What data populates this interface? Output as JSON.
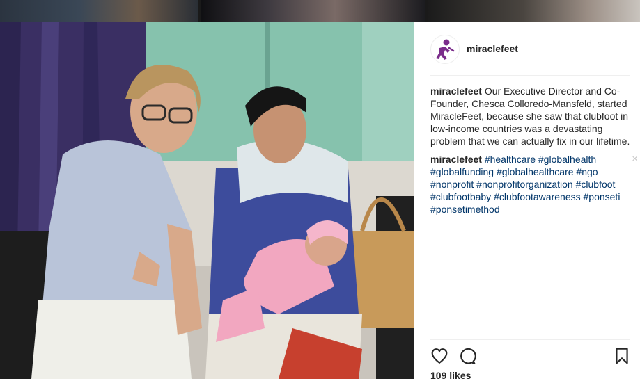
{
  "post": {
    "username": "miraclefeet",
    "caption": {
      "user": "miraclefeet",
      "text": " Our Executive Director and Co-Founder, Chesca Colloredo-Mansfeld, started MiracleFeet, because she saw that clubfoot in low-income countries was a devastating problem that we can actually fix in our lifetime."
    },
    "hashtag_comment": {
      "user": "miraclefeet",
      "tags": [
        "#healthcare",
        "#globalhealth",
        "#globalfunding",
        "#globalhealthcare",
        "#ngo",
        "#nonprofit",
        "#nonprofitorganization",
        "#clubfoot",
        "#clubfootbaby",
        "#clubfootawareness",
        "#ponseti",
        "#ponsetimethod"
      ],
      "close_symbol": "×"
    },
    "likes": "109 likes"
  },
  "icons": [
    "heart-icon",
    "comment-icon",
    "bookmark-icon",
    "miraclefeet-logo"
  ],
  "colors": {
    "text": "#262626",
    "link": "#003569",
    "logo_purple": "#7b2d8b",
    "divider": "#efefef"
  }
}
